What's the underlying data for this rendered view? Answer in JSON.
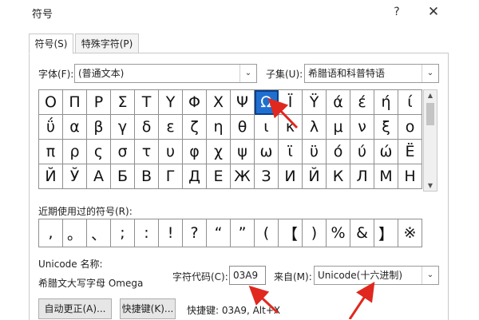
{
  "title": "符号",
  "help_glyph": "?",
  "close_glyph": "✕",
  "tabs": [
    {
      "label": "符号(S)"
    },
    {
      "label": "特殊字符(P)"
    }
  ],
  "font": {
    "label": "字体(F):",
    "value": "(普通文本)",
    "arrow": "⌄"
  },
  "subset": {
    "label": "子集(U):",
    "value": "希腊语和科普特语",
    "arrow": "⌄"
  },
  "symbol_grid": [
    [
      "Ο",
      "Π",
      "Ρ",
      "Σ",
      "Τ",
      "Υ",
      "Φ",
      "Χ",
      "Ψ",
      "Ω",
      "Ϊ",
      "Ϋ",
      "ά",
      "έ",
      "ή",
      "ί"
    ],
    [
      "ΰ",
      "α",
      "β",
      "γ",
      "δ",
      "ε",
      "ζ",
      "η",
      "θ",
      "ι",
      "κ",
      "λ",
      "μ",
      "ν",
      "ξ",
      "ο"
    ],
    [
      "π",
      "ρ",
      "ς",
      "σ",
      "τ",
      "υ",
      "φ",
      "χ",
      "ψ",
      "ω",
      "ϊ",
      "ϋ",
      "ό",
      "ύ",
      "ώ",
      "Ё"
    ],
    [
      "Й",
      "Ў",
      "А",
      "Б",
      "В",
      "Г",
      "Д",
      "Е",
      "Ж",
      "З",
      "И",
      "Й",
      "К",
      "Л",
      "М",
      "Н"
    ]
  ],
  "selected_symbol": "Ω",
  "scroll": {
    "up": "▲",
    "down": "▼"
  },
  "recent": {
    "label": "近期使用过的符号(R):",
    "symbols": [
      ",",
      "。",
      "、",
      ";",
      ":",
      "!",
      "?",
      "“",
      "”",
      "(",
      "【",
      ")",
      "%",
      "&",
      "】",
      "※"
    ]
  },
  "unicode_name": {
    "label": "Unicode 名称:",
    "value": "希腊文大写字母 Omega"
  },
  "char_code": {
    "label": "字符代码(C):",
    "value": "03A9"
  },
  "from": {
    "label": "来自(M):",
    "value": "Unicode(十六进制)",
    "arrow": "⌄"
  },
  "buttons": {
    "autocorrect": "自动更正(A)...",
    "shortcut_key": "快捷键(K)..."
  },
  "shortcut_text": "快捷键: 03A9, Alt+X",
  "annotation_color": "#e0281e",
  "selection_color": "#1f6fd1"
}
